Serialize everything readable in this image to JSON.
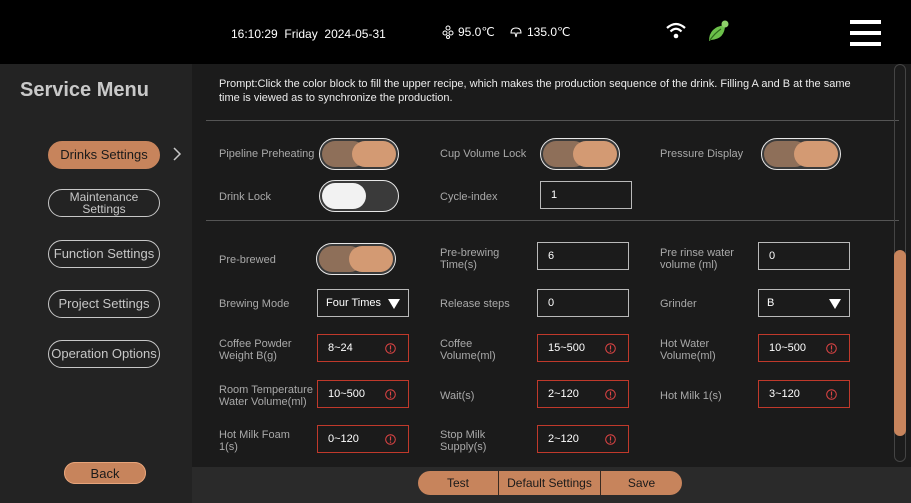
{
  "status_bar": {
    "time": "16:10:29",
    "day": "Friday",
    "date": "2024-05-31",
    "boiler1_temp": "95.0℃",
    "boiler2_temp": "135.0℃"
  },
  "sidebar": {
    "title": "Service Menu",
    "items": [
      {
        "label": "Drinks Settings"
      },
      {
        "label_line1": "Maintenance",
        "label_line2": "Settings"
      },
      {
        "label": "Function Settings"
      },
      {
        "label": "Project Settings"
      },
      {
        "label": "Operation Options"
      }
    ],
    "back_label": "Back"
  },
  "prompt": "Prompt:Click the color block to fill the upper recipe, which makes the production sequence of the drink. Filling A and B at the same time is viewed as to synchronize the production.",
  "toggles": {
    "pipeline_preheating": {
      "label": "Pipeline Preheating",
      "on": true
    },
    "cup_volume_lock": {
      "label": "Cup Volume Lock",
      "on": true
    },
    "pressure_display": {
      "label": "Pressure Display",
      "on": true
    },
    "drink_lock": {
      "label": "Drink Lock",
      "on": false
    },
    "pre_brewed": {
      "label": "Pre-brewed",
      "on": true
    }
  },
  "fields": {
    "cycle_index": {
      "label": "Cycle-index",
      "value": "1"
    },
    "pre_brewing_time": {
      "label_line1": "Pre-brewing",
      "label_line2": "Time(s)",
      "value": "6"
    },
    "pre_rinse_water": {
      "label_line1": "Pre rinse water",
      "label_line2": "volume (ml)",
      "value": "0"
    },
    "brewing_mode": {
      "label": "Brewing Mode",
      "value": "Four Times"
    },
    "release_steps": {
      "label": "Release steps",
      "value": "0"
    },
    "grinder": {
      "label": "Grinder",
      "value": "B"
    },
    "coffee_powder_weight": {
      "label_line1": "Coffee Powder",
      "label_line2": "Weight B(g)",
      "value": "8~24"
    },
    "coffee_volume": {
      "label_line1": "Coffee",
      "label_line2": "Volume(ml)",
      "value": "15~500"
    },
    "hot_water_volume": {
      "label_line1": "Hot Water",
      "label_line2": "Volume(ml)",
      "value": "10~500"
    },
    "room_temp_water": {
      "label_line1": "Room Temperature",
      "label_line2": "Water Volume(ml)",
      "value": "10~500"
    },
    "wait": {
      "label": "Wait(s)",
      "value": "2~120"
    },
    "hot_milk": {
      "label": "Hot Milk 1(s)",
      "value": "3~120"
    },
    "hot_milk_foam": {
      "label_line1": "Hot Milk Foam",
      "label_line2": "1(s)",
      "value": "0~120"
    },
    "stop_milk_supply": {
      "label_line1": "Stop Milk",
      "label_line2": "Supply(s)",
      "value": "2~120"
    }
  },
  "bottom_bar": {
    "test_label": "Test",
    "default_label": "Default Settings",
    "save_label": "Save"
  },
  "colors": {
    "accent": "#c7845c",
    "error": "#c0392b",
    "background": "#1b1b1b"
  }
}
